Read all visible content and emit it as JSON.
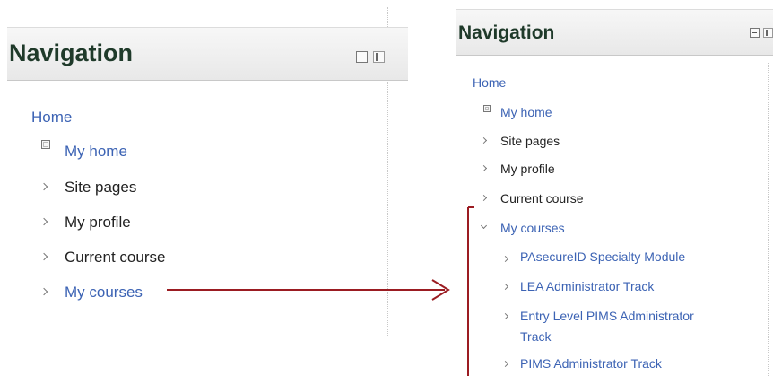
{
  "left_block": {
    "title": "Navigation",
    "items": [
      {
        "label": "Home",
        "icon": "none"
      },
      {
        "label": "My home",
        "icon": "square-icon"
      },
      {
        "label": "Site pages",
        "icon": "chevron-right-icon"
      },
      {
        "label": "My profile",
        "icon": "chevron-right-icon"
      },
      {
        "label": "Current course",
        "icon": "chevron-right-icon"
      },
      {
        "label": "My courses",
        "icon": "chevron-right-icon"
      }
    ]
  },
  "right_block": {
    "title": "Navigation",
    "items": [
      {
        "label": "Home",
        "icon": "none"
      },
      {
        "label": "My home",
        "icon": "square-icon"
      },
      {
        "label": "Site pages",
        "icon": "chevron-right-icon"
      },
      {
        "label": "My profile",
        "icon": "chevron-right-icon"
      },
      {
        "label": "Current course",
        "icon": "chevron-right-icon"
      },
      {
        "label": "My courses",
        "icon": "chevron-down-icon"
      }
    ],
    "courses": [
      {
        "label": "PAsecureID Specialty Module"
      },
      {
        "label": "LEA Administrator Track"
      },
      {
        "label": "Entry Level PIMS Administrator",
        "label_line2": "Track"
      },
      {
        "label": "PIMS Administrator Track"
      }
    ]
  },
  "colors": {
    "link": "#3c63b4",
    "title": "#1f3a2a",
    "arrow": "#9b1c22"
  }
}
